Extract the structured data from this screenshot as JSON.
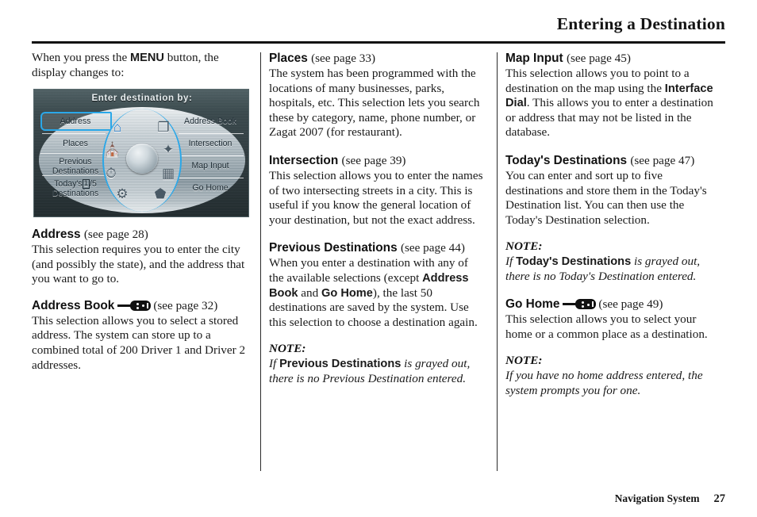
{
  "header": {
    "title": "Entering a Destination"
  },
  "footer": {
    "section": "Navigation System",
    "page_number": "27"
  },
  "columns": {
    "left": {
      "intro": "When you press the MENU button, the display changes to:",
      "intro_before": "When you press the ",
      "intro_bold": "MENU",
      "intro_after": " button, the display changes to:",
      "figure": {
        "title": "Enter destination by:",
        "selected_button": "Address",
        "left_buttons": [
          {
            "label": "Address"
          },
          {
            "label": "Places"
          },
          {
            "label_line1": "Previous",
            "label_line2": "Destinations"
          },
          {
            "label_line1": "Today's",
            "count": "1",
            "count_suffix": "/5",
            "label_line2": "Destinations"
          }
        ],
        "right_buttons": [
          {
            "label": "Address Book"
          },
          {
            "label": "Intersection"
          },
          {
            "label": "Map Input"
          },
          {
            "label": "Go Home"
          }
        ],
        "icons": [
          {
            "name": "address-house-icon",
            "glyph": "⌂"
          },
          {
            "name": "address-book-icon",
            "glyph": "❐"
          },
          {
            "name": "places-icon",
            "glyph": "⛪"
          },
          {
            "name": "intersection-icon",
            "glyph": "✦"
          },
          {
            "name": "previous-destinations-icon",
            "glyph": "⏱"
          },
          {
            "name": "map-input-icon",
            "glyph": "▦"
          },
          {
            "name": "todays-destinations-icon",
            "glyph": "⚙"
          },
          {
            "name": "go-home-icon",
            "glyph": "⬟"
          }
        ],
        "center_knob": "interface-dial"
      },
      "entries": [
        {
          "heading": "Address",
          "ref": "(see page 28)",
          "has_key_icon": false,
          "body": "This selection requires you to enter the city (and possibly the state), and the address that you want to go to."
        },
        {
          "heading": "Address Book",
          "ref": "(see page 32)",
          "has_key_icon": true,
          "body": "This selection allows you to select a stored address. The system can store up to a combined total of 200 Driver 1 and Driver 2 addresses."
        }
      ]
    },
    "middle": {
      "entries": [
        {
          "heading": "Places",
          "ref": "(see page 33)",
          "has_key_icon": false,
          "body": "The system has been programmed with the locations of many businesses, parks, hospitals, etc. This selection lets you search these by category, name, phone number, or Zagat 2007 (for restaurant)."
        },
        {
          "heading": "Intersection",
          "ref": "(see page 39)",
          "has_key_icon": false,
          "body": "This selection allows you to enter the names of two intersecting streets in a city. This is useful if you know the general location of your destination, but not the exact address."
        },
        {
          "heading": "Previous Destinations",
          "ref": "(see page 44)",
          "has_key_icon": false,
          "body_part1": "When you enter a destination with any of the available selections (except ",
          "body_bold1": "Address Book",
          "body_mid": " and ",
          "body_bold2": "Go Home",
          "body_part2": "), the last 50 destinations are saved by the system. Use this selection to choose a destination again."
        }
      ],
      "note": {
        "label": "NOTE:",
        "if_word": "If ",
        "bold_term": "Previous Destinations",
        "rest": " is grayed out, there is no Previous Destination entered."
      }
    },
    "right": {
      "entries": [
        {
          "heading": "Map Input",
          "ref": "(see page 45)",
          "has_key_icon": false,
          "body_part1": "This selection allows you to point to a destination on the map using the ",
          "body_bold1": "Interface Dial",
          "body_part2": ". This allows you to enter a destination or address that may not be listed in the database."
        },
        {
          "heading": "Today's Destinations",
          "ref": "(see page 47)",
          "has_key_icon": false,
          "body": "You can enter and sort up to five destinations and store them in the Today's Destination list. You can then use the Today's Destination selection."
        }
      ],
      "note1": {
        "label": "NOTE:",
        "if_word": "If ",
        "bold_term": "Today's Destinations",
        "rest": " is grayed out, there is no Today's Destination entered."
      },
      "gohome": {
        "heading": "Go Home",
        "ref": "(see page 49)",
        "has_key_icon": true,
        "body": "This selection allows you to select your home or a common place as a destination."
      },
      "note2": {
        "label": "NOTE:",
        "text": "If you have no home address entered, the system prompts you for one."
      }
    }
  },
  "colors": {
    "nav_accent": "#2aa7e8",
    "text": "#1a1a1a",
    "rule": "#111111"
  }
}
